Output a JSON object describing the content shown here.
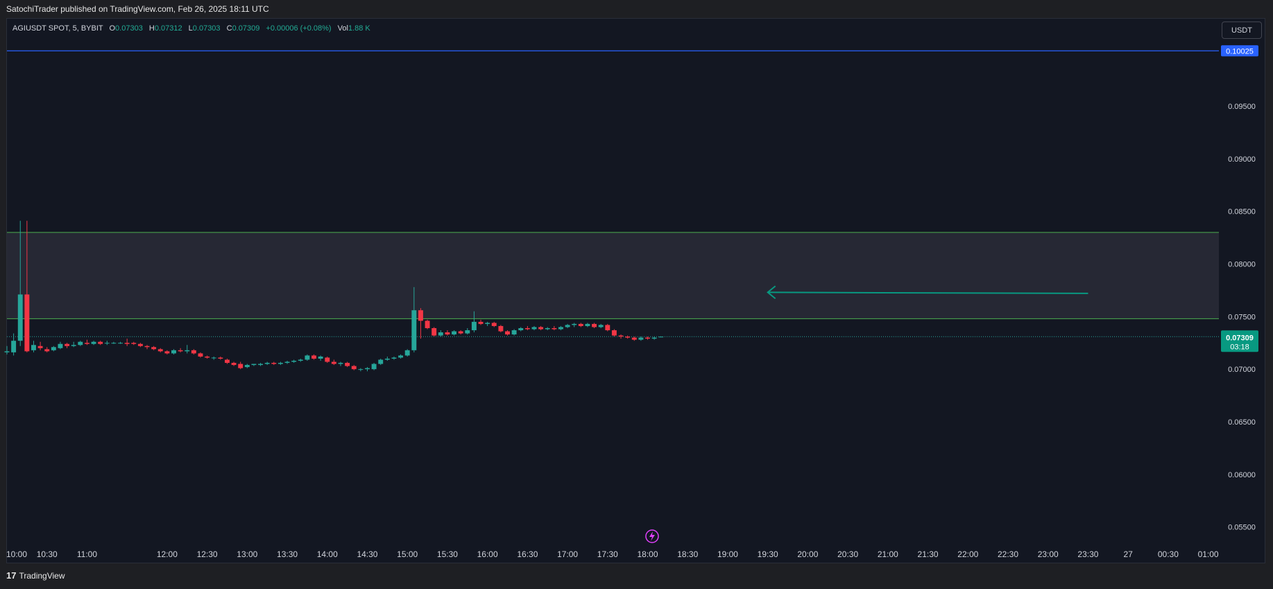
{
  "header": {
    "published_text": "SatochiTrader published on TradingView.com, Feb 26, 2025 18:11 UTC"
  },
  "legend": {
    "symbol": "AGIUSDT SPOT, 5, BYBIT",
    "o_label": "O",
    "o_value": "0.07303",
    "h_label": "H",
    "h_value": "0.07312",
    "l_label": "L",
    "l_value": "0.07303",
    "c_label": "C",
    "c_value": "0.07309",
    "change": "+0.00006 (+0.08%)",
    "vol_label": "Vol",
    "vol_value": "1.88 K"
  },
  "currency_button": "USDT",
  "footer": {
    "brand": "TradingView",
    "logo_glyph": "17"
  },
  "colors": {
    "background": "#131722",
    "up": "#26a69a",
    "down": "#f23645",
    "level_line": "#2962ff",
    "zone_line": "#4caf50",
    "arrow": "#089981",
    "price_tag": "#089981",
    "lightning": "#e040fb"
  },
  "chart_data": {
    "type": "candlestick",
    "y_axis": {
      "ticks": [
        0.055,
        0.06,
        0.065,
        0.07,
        0.075,
        0.08,
        0.085,
        0.09,
        0.095
      ],
      "tick_labels": [
        "0.05500",
        "0.06000",
        "0.06500",
        "0.07000",
        "0.07500",
        "0.08000",
        "0.08500",
        "0.09000",
        "0.09500"
      ],
      "range": [
        0.0532,
        0.1033
      ]
    },
    "x_axis": {
      "tick_labels": [
        "10:00",
        "10:30",
        "11:00",
        "12:00",
        "12:30",
        "13:00",
        "13:30",
        "14:00",
        "14:30",
        "15:00",
        "15:30",
        "16:00",
        "16:30",
        "17:00",
        "17:30",
        "18:00",
        "18:30",
        "19:00",
        "19:30",
        "20:00",
        "20:30",
        "21:00",
        "21:30",
        "22:00",
        "22:30",
        "23:00",
        "23:30",
        "27",
        "00:30",
        "01:00"
      ],
      "tick_times": [
        600,
        630,
        660,
        720,
        750,
        780,
        810,
        840,
        870,
        900,
        930,
        960,
        990,
        1020,
        1050,
        1080,
        1110,
        1140,
        1170,
        1200,
        1230,
        1260,
        1290,
        1320,
        1350,
        1380,
        1410,
        1440,
        1470,
        1500
      ],
      "unit": "minutes since Feb 26 00:00",
      "range": [
        600,
        1508
      ]
    },
    "horizontal_line": {
      "price": 0.10025,
      "label": "0.10025"
    },
    "zone": {
      "top": 0.083,
      "bottom": 0.0748
    },
    "current_price": {
      "price": 0.07309,
      "label": "0.07309",
      "countdown": "03:18"
    },
    "arrow": {
      "from": {
        "t": 1410,
        "price": 0.0772
      },
      "to": {
        "t": 1170,
        "price": 0.0773
      }
    },
    "candles": [
      {
        "t": 600,
        "o": 0.0716,
        "h": 0.0722,
        "l": 0.0714,
        "c": 0.0717
      },
      {
        "t": 605,
        "o": 0.0716,
        "h": 0.0734,
        "l": 0.0713,
        "c": 0.0727
      },
      {
        "t": 610,
        "o": 0.0727,
        "h": 0.0841,
        "l": 0.0722,
        "c": 0.0771
      },
      {
        "t": 615,
        "o": 0.0771,
        "h": 0.0841,
        "l": 0.0716,
        "c": 0.0717
      },
      {
        "t": 620,
        "o": 0.0718,
        "h": 0.0727,
        "l": 0.0716,
        "c": 0.0723
      },
      {
        "t": 625,
        "o": 0.0722,
        "h": 0.0726,
        "l": 0.0718,
        "c": 0.072
      },
      {
        "t": 630,
        "o": 0.0719,
        "h": 0.0721,
        "l": 0.0716,
        "c": 0.0717
      },
      {
        "t": 635,
        "o": 0.0718,
        "h": 0.0722,
        "l": 0.0717,
        "c": 0.0721
      },
      {
        "t": 640,
        "o": 0.072,
        "h": 0.0726,
        "l": 0.0719,
        "c": 0.0724
      },
      {
        "t": 645,
        "o": 0.0724,
        "h": 0.0725,
        "l": 0.072,
        "c": 0.0722
      },
      {
        "t": 650,
        "o": 0.0722,
        "h": 0.0726,
        "l": 0.0721,
        "c": 0.0723
      },
      {
        "t": 655,
        "o": 0.0723,
        "h": 0.0727,
        "l": 0.0722,
        "c": 0.0726
      },
      {
        "t": 660,
        "o": 0.0725,
        "h": 0.0728,
        "l": 0.0723,
        "c": 0.0724
      },
      {
        "t": 665,
        "o": 0.0724,
        "h": 0.0727,
        "l": 0.0723,
        "c": 0.0726
      },
      {
        "t": 670,
        "o": 0.0726,
        "h": 0.0727,
        "l": 0.0723,
        "c": 0.0724
      },
      {
        "t": 675,
        "o": 0.0725,
        "h": 0.0727,
        "l": 0.0723,
        "c": 0.0725
      },
      {
        "t": 680,
        "o": 0.0725,
        "h": 0.0726,
        "l": 0.0724,
        "c": 0.0725
      },
      {
        "t": 685,
        "o": 0.0725,
        "h": 0.0726,
        "l": 0.0724,
        "c": 0.0725
      },
      {
        "t": 690,
        "o": 0.0725,
        "h": 0.0729,
        "l": 0.0722,
        "c": 0.0724
      },
      {
        "t": 695,
        "o": 0.0725,
        "h": 0.0726,
        "l": 0.0723,
        "c": 0.0724
      },
      {
        "t": 700,
        "o": 0.0724,
        "h": 0.0725,
        "l": 0.0721,
        "c": 0.0722
      },
      {
        "t": 705,
        "o": 0.0722,
        "h": 0.0723,
        "l": 0.0719,
        "c": 0.0721
      },
      {
        "t": 710,
        "o": 0.0721,
        "h": 0.0722,
        "l": 0.0718,
        "c": 0.0719
      },
      {
        "t": 715,
        "o": 0.0719,
        "h": 0.072,
        "l": 0.0716,
        "c": 0.0717
      },
      {
        "t": 720,
        "o": 0.0717,
        "h": 0.0718,
        "l": 0.0714,
        "c": 0.0715
      },
      {
        "t": 725,
        "o": 0.0715,
        "h": 0.0719,
        "l": 0.0714,
        "c": 0.0718
      },
      {
        "t": 730,
        "o": 0.0718,
        "h": 0.072,
        "l": 0.0716,
        "c": 0.0717
      },
      {
        "t": 735,
        "o": 0.0717,
        "h": 0.0723,
        "l": 0.0715,
        "c": 0.0718
      },
      {
        "t": 740,
        "o": 0.0718,
        "h": 0.0719,
        "l": 0.0714,
        "c": 0.0715
      },
      {
        "t": 745,
        "o": 0.0715,
        "h": 0.0716,
        "l": 0.0711,
        "c": 0.0712
      },
      {
        "t": 750,
        "o": 0.0712,
        "h": 0.0713,
        "l": 0.071,
        "c": 0.0711
      },
      {
        "t": 755,
        "o": 0.0711,
        "h": 0.0712,
        "l": 0.0709,
        "c": 0.0711
      },
      {
        "t": 760,
        "o": 0.0711,
        "h": 0.0712,
        "l": 0.0709,
        "c": 0.071
      },
      {
        "t": 765,
        "o": 0.0709,
        "h": 0.071,
        "l": 0.0705,
        "c": 0.0706
      },
      {
        "t": 770,
        "o": 0.0706,
        "h": 0.0707,
        "l": 0.0703,
        "c": 0.0704
      },
      {
        "t": 775,
        "o": 0.0705,
        "h": 0.0707,
        "l": 0.07,
        "c": 0.0701
      },
      {
        "t": 780,
        "o": 0.0702,
        "h": 0.0705,
        "l": 0.0701,
        "c": 0.0704
      },
      {
        "t": 785,
        "o": 0.0704,
        "h": 0.0705,
        "l": 0.0703,
        "c": 0.0705
      },
      {
        "t": 790,
        "o": 0.0704,
        "h": 0.0706,
        "l": 0.0703,
        "c": 0.0705
      },
      {
        "t": 795,
        "o": 0.0705,
        "h": 0.0707,
        "l": 0.0704,
        "c": 0.0706
      },
      {
        "t": 800,
        "o": 0.0706,
        "h": 0.0707,
        "l": 0.0704,
        "c": 0.0705
      },
      {
        "t": 805,
        "o": 0.0705,
        "h": 0.0707,
        "l": 0.0704,
        "c": 0.0706
      },
      {
        "t": 810,
        "o": 0.0706,
        "h": 0.0708,
        "l": 0.0705,
        "c": 0.0707
      },
      {
        "t": 815,
        "o": 0.0707,
        "h": 0.0709,
        "l": 0.0706,
        "c": 0.0708
      },
      {
        "t": 820,
        "o": 0.0708,
        "h": 0.071,
        "l": 0.0707,
        "c": 0.0709
      },
      {
        "t": 825,
        "o": 0.0709,
        "h": 0.0714,
        "l": 0.0708,
        "c": 0.0713
      },
      {
        "t": 830,
        "o": 0.0713,
        "h": 0.0714,
        "l": 0.0709,
        "c": 0.071
      },
      {
        "t": 835,
        "o": 0.071,
        "h": 0.0713,
        "l": 0.0708,
        "c": 0.0712
      },
      {
        "t": 840,
        "o": 0.0711,
        "h": 0.0712,
        "l": 0.0706,
        "c": 0.0707
      },
      {
        "t": 845,
        "o": 0.0707,
        "h": 0.0709,
        "l": 0.0704,
        "c": 0.0705
      },
      {
        "t": 850,
        "o": 0.0705,
        "h": 0.0707,
        "l": 0.0703,
        "c": 0.0706
      },
      {
        "t": 855,
        "o": 0.0706,
        "h": 0.0707,
        "l": 0.0702,
        "c": 0.0703
      },
      {
        "t": 860,
        "o": 0.0703,
        "h": 0.0704,
        "l": 0.0699,
        "c": 0.07
      },
      {
        "t": 865,
        "o": 0.07,
        "h": 0.0701,
        "l": 0.0698,
        "c": 0.07
      },
      {
        "t": 870,
        "o": 0.07,
        "h": 0.0702,
        "l": 0.0698,
        "c": 0.0701
      },
      {
        "t": 875,
        "o": 0.07,
        "h": 0.0706,
        "l": 0.0699,
        "c": 0.0705
      },
      {
        "t": 880,
        "o": 0.0705,
        "h": 0.071,
        "l": 0.0704,
        "c": 0.0709
      },
      {
        "t": 885,
        "o": 0.0709,
        "h": 0.0712,
        "l": 0.0708,
        "c": 0.071
      },
      {
        "t": 890,
        "o": 0.071,
        "h": 0.0712,
        "l": 0.0709,
        "c": 0.0711
      },
      {
        "t": 895,
        "o": 0.0711,
        "h": 0.0714,
        "l": 0.071,
        "c": 0.0713
      },
      {
        "t": 900,
        "o": 0.0713,
        "h": 0.0719,
        "l": 0.0712,
        "c": 0.0718
      },
      {
        "t": 905,
        "o": 0.0718,
        "h": 0.0778,
        "l": 0.0716,
        "c": 0.0756
      },
      {
        "t": 910,
        "o": 0.0756,
        "h": 0.0758,
        "l": 0.0729,
        "c": 0.0746
      },
      {
        "t": 915,
        "o": 0.0746,
        "h": 0.0747,
        "l": 0.0738,
        "c": 0.0739
      },
      {
        "t": 920,
        "o": 0.0739,
        "h": 0.074,
        "l": 0.0731,
        "c": 0.0732
      },
      {
        "t": 925,
        "o": 0.0732,
        "h": 0.0737,
        "l": 0.0731,
        "c": 0.0735
      },
      {
        "t": 930,
        "o": 0.0735,
        "h": 0.0737,
        "l": 0.0732,
        "c": 0.0733
      },
      {
        "t": 935,
        "o": 0.0733,
        "h": 0.0737,
        "l": 0.0732,
        "c": 0.0736
      },
      {
        "t": 940,
        "o": 0.0736,
        "h": 0.0737,
        "l": 0.0733,
        "c": 0.0734
      },
      {
        "t": 945,
        "o": 0.0734,
        "h": 0.0739,
        "l": 0.0733,
        "c": 0.0737
      },
      {
        "t": 950,
        "o": 0.0737,
        "h": 0.0755,
        "l": 0.0735,
        "c": 0.0745
      },
      {
        "t": 955,
        "o": 0.0745,
        "h": 0.0747,
        "l": 0.0742,
        "c": 0.0743
      },
      {
        "t": 960,
        "o": 0.0743,
        "h": 0.0745,
        "l": 0.0741,
        "c": 0.0744
      },
      {
        "t": 965,
        "o": 0.0744,
        "h": 0.0745,
        "l": 0.074,
        "c": 0.0741
      },
      {
        "t": 970,
        "o": 0.0741,
        "h": 0.0742,
        "l": 0.0735,
        "c": 0.0736
      },
      {
        "t": 975,
        "o": 0.0736,
        "h": 0.0737,
        "l": 0.0732,
        "c": 0.0733
      },
      {
        "t": 980,
        "o": 0.0733,
        "h": 0.0738,
        "l": 0.0732,
        "c": 0.0737
      },
      {
        "t": 985,
        "o": 0.0737,
        "h": 0.074,
        "l": 0.0736,
        "c": 0.0739
      },
      {
        "t": 990,
        "o": 0.0739,
        "h": 0.0741,
        "l": 0.0737,
        "c": 0.0738
      },
      {
        "t": 995,
        "o": 0.0738,
        "h": 0.0741,
        "l": 0.0737,
        "c": 0.074
      },
      {
        "t": 1000,
        "o": 0.074,
        "h": 0.0741,
        "l": 0.0737,
        "c": 0.0738
      },
      {
        "t": 1005,
        "o": 0.0738,
        "h": 0.074,
        "l": 0.0737,
        "c": 0.0739
      },
      {
        "t": 1010,
        "o": 0.0739,
        "h": 0.0741,
        "l": 0.0737,
        "c": 0.0738
      },
      {
        "t": 1015,
        "o": 0.0738,
        "h": 0.0741,
        "l": 0.0737,
        "c": 0.074
      },
      {
        "t": 1020,
        "o": 0.074,
        "h": 0.0743,
        "l": 0.0739,
        "c": 0.0742
      },
      {
        "t": 1025,
        "o": 0.0742,
        "h": 0.0744,
        "l": 0.074,
        "c": 0.0743
      },
      {
        "t": 1030,
        "o": 0.0743,
        "h": 0.0744,
        "l": 0.074,
        "c": 0.0741
      },
      {
        "t": 1035,
        "o": 0.0741,
        "h": 0.0744,
        "l": 0.074,
        "c": 0.0743
      },
      {
        "t": 1040,
        "o": 0.0743,
        "h": 0.0744,
        "l": 0.0739,
        "c": 0.074
      },
      {
        "t": 1045,
        "o": 0.074,
        "h": 0.0743,
        "l": 0.0739,
        "c": 0.0742
      },
      {
        "t": 1050,
        "o": 0.0742,
        "h": 0.0743,
        "l": 0.0736,
        "c": 0.0737
      },
      {
        "t": 1055,
        "o": 0.0737,
        "h": 0.0738,
        "l": 0.0731,
        "c": 0.0732
      },
      {
        "t": 1060,
        "o": 0.0732,
        "h": 0.0733,
        "l": 0.0729,
        "c": 0.0731
      },
      {
        "t": 1065,
        "o": 0.0731,
        "h": 0.0732,
        "l": 0.0729,
        "c": 0.073
      },
      {
        "t": 1070,
        "o": 0.073,
        "h": 0.0731,
        "l": 0.0727,
        "c": 0.0728
      },
      {
        "t": 1075,
        "o": 0.0728,
        "h": 0.0731,
        "l": 0.0727,
        "c": 0.073
      },
      {
        "t": 1080,
        "o": 0.073,
        "h": 0.0731,
        "l": 0.0728,
        "c": 0.0729
      },
      {
        "t": 1085,
        "o": 0.0729,
        "h": 0.0731,
        "l": 0.0728,
        "c": 0.073
      },
      {
        "t": 1090,
        "o": 0.07303,
        "h": 0.07312,
        "l": 0.07303,
        "c": 0.07309
      }
    ]
  }
}
